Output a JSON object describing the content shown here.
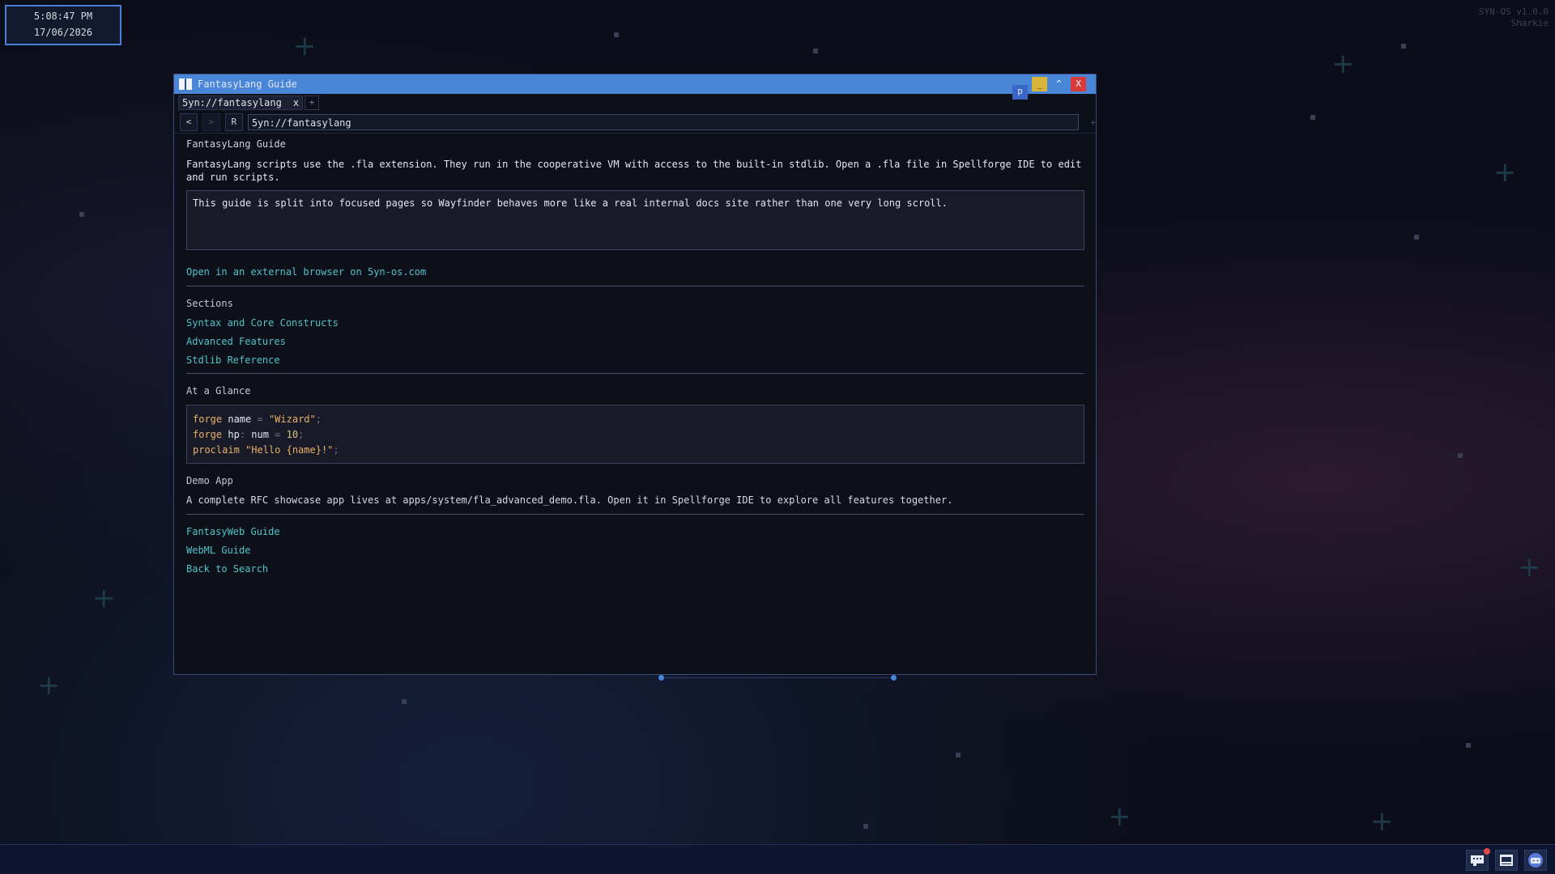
{
  "clock": {
    "time": "5:08:47 PM",
    "date": "17/06/2026"
  },
  "system": {
    "version": "SYN-OS v1.0.0",
    "user": "Sharkie"
  },
  "window": {
    "title": "FantasyLang Guide",
    "controls": {
      "p": "p",
      "minimize": "_",
      "maximize": "^",
      "close": "X"
    }
  },
  "tabs": [
    {
      "label": "5yn://fantasylang",
      "close": "x"
    }
  ],
  "new_tab": "+",
  "nav": {
    "back": "<",
    "forward": ">",
    "reload": "R",
    "url": "5yn://fantasylang",
    "extra": "+"
  },
  "page": {
    "title": "FantasyLang Guide",
    "intro": "FantasyLang scripts use the .fla extension. They run in the cooperative VM with access to the built-in stdlib. Open a .fla file in Spellforge IDE to edit and run scripts.",
    "note": "This guide is split into focused pages so Wayfinder behaves more like a real internal docs site rather than one very long scroll.",
    "external_link": "Open in an external browser on 5yn-os.com",
    "sections_heading": "Sections",
    "sections": [
      "Syntax and Core Constructs",
      "Advanced Features",
      "Stdlib Reference"
    ],
    "glance_heading": "At a Glance",
    "code": {
      "line1": {
        "kw": "forge",
        "name": "name",
        "eq": " = ",
        "val": "\"Wizard\"",
        "end": ";"
      },
      "line2": {
        "kw": "forge",
        "name": "hp",
        "colon": ": ",
        "type": "num",
        "eq": " = ",
        "val": "10",
        "end": ";"
      },
      "line3": {
        "kw": "proclaim",
        "val": "\"Hello {name}!\"",
        "end": ";"
      }
    },
    "demo_heading": "Demo App",
    "demo_text": "A complete RFC showcase app lives at apps/system/fla_advanced_demo.fla. Open it in Spellforge IDE to explore all features together.",
    "footer_links": [
      "FantasyWeb Guide",
      "WebML Guide",
      "Back to Search"
    ]
  },
  "colors": {
    "accent": "#4a86d8",
    "link": "#4fc3c9",
    "close": "#d83a3a",
    "minimize": "#d8b43a"
  }
}
